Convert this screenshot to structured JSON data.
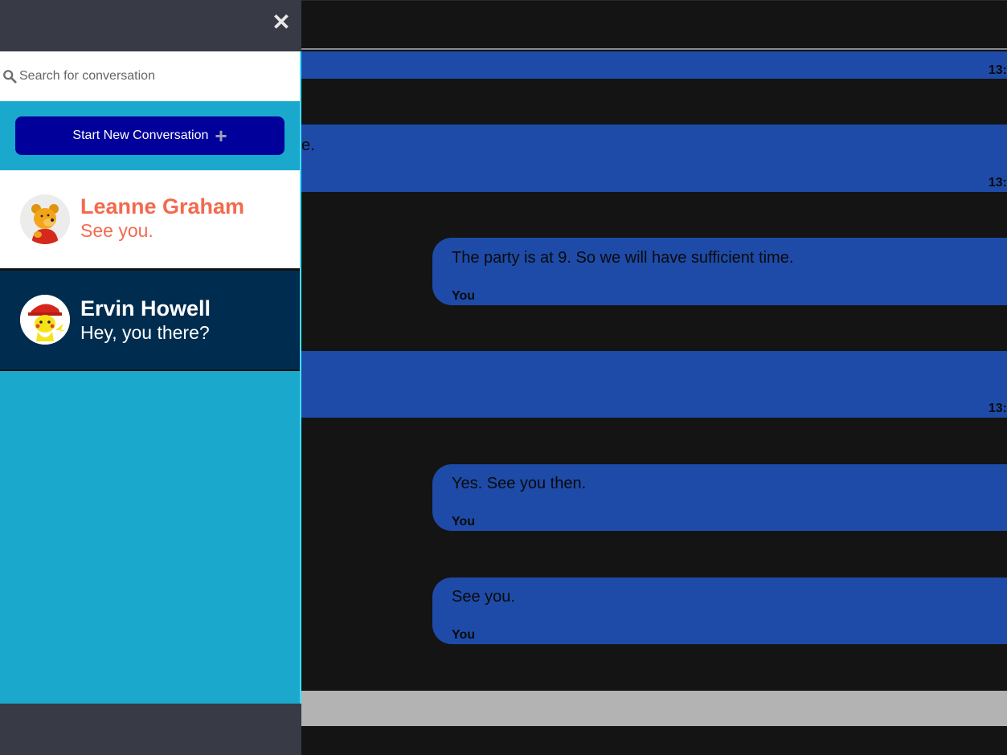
{
  "sidebar": {
    "close_icon": "close-icon",
    "search": {
      "placeholder": "Search for conversation",
      "value": ""
    },
    "new_conversation_label": "Start New Conversation",
    "conversations": [
      {
        "name": "Leanne Graham",
        "last_message": "See you.",
        "avatar": "winnie-the-pooh",
        "active": false
      },
      {
        "name": "Ervin Howell",
        "last_message": "Hey, you there?",
        "avatar": "pikachu",
        "active": true
      }
    ]
  },
  "chat": {
    "messages": [
      {
        "direction": "in",
        "text": "",
        "time": "13:"
      },
      {
        "direction": "in",
        "text": "e.",
        "time": "13:"
      },
      {
        "direction": "out",
        "text": "The party is at 9. So we will have sufficient time.",
        "author": "You"
      },
      {
        "direction": "in",
        "text": "",
        "time": "13:"
      },
      {
        "direction": "out",
        "text": "Yes. See you then.",
        "author": "You"
      },
      {
        "direction": "out",
        "text": "See you.",
        "author": "You"
      }
    ]
  },
  "colors": {
    "sidebar_bg": "#1aa8cc",
    "header_bg": "#383b46",
    "button_bg": "#01009a",
    "message_bg": "#1e4ba8",
    "chat_bg": "#141414",
    "inactive_name": "#f26a4f",
    "active_item_bg": "#002d4f"
  }
}
